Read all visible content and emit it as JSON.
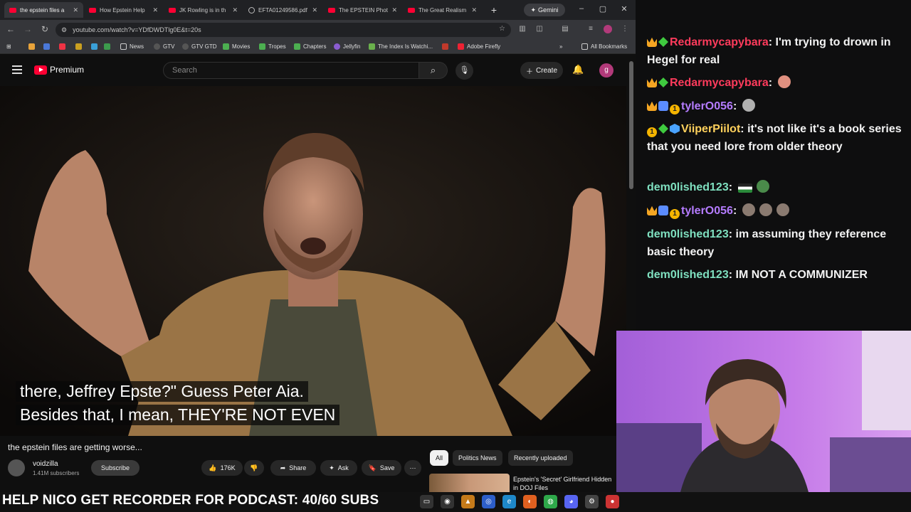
{
  "browser": {
    "tabs": [
      {
        "title": "the epstein files a",
        "active": true,
        "icon": "youtube-icon"
      },
      {
        "title": "How Epstein Help",
        "active": false,
        "icon": "youtube-icon"
      },
      {
        "title": "JK Rowling is in th",
        "active": false,
        "icon": "youtube-icon"
      },
      {
        "title": "EFTA01249586.pdf",
        "active": false,
        "icon": "document-icon"
      },
      {
        "title": "The EPSTEIN Phot",
        "active": false,
        "icon": "youtube-icon"
      },
      {
        "title": "The Great Realism",
        "active": false,
        "icon": "youtube-icon"
      }
    ],
    "gemini_label": "Gemini",
    "url": "youtube.com/watch?v=YDfDWDTlg0E&t=20s",
    "bookmarks": [
      "News",
      "GTV",
      "GTV GTD",
      "Movies",
      "Tropes",
      "Chapters",
      "Jellyfin",
      "The Index Is Watchi...",
      "Adobe Firefly"
    ],
    "all_bookmarks_label": "All Bookmarks"
  },
  "youtube": {
    "logo_label": "Premium",
    "search_placeholder": "Search",
    "create_label": "Create",
    "avatar_letter": "g",
    "captions": [
      "there, Jeffrey Epste?\" Guess Peter Aia.",
      "Besides that, I mean, THEY'RE NOT EVEN"
    ],
    "video_title": "the epstein files are getting worse...",
    "channel_name": "voidzilla",
    "channel_subs": "1.41M subscribers",
    "subscribe_label": "Subscribe",
    "likes": "176K",
    "share_label": "Share",
    "ask_label": "Ask",
    "save_label": "Save",
    "chips": [
      "All",
      "Politics News",
      "Recently uploaded"
    ],
    "recommended_title": "Epstein's 'Secret' Girlfriend Hidden in DOJ Files"
  },
  "chat": {
    "messages": [
      {
        "user": "Redarmycapybara",
        "color": "#ff3b5c",
        "text": "I'm trying to drown in Hegel for real",
        "badges": [
          "crown",
          "gem"
        ]
      },
      {
        "user": "Redarmycapybara",
        "color": "#ff3b5c",
        "text": "",
        "badges": [
          "crown",
          "gem"
        ],
        "emote": "#e09080"
      },
      {
        "user": "tylerO056",
        "color": "#b57cff",
        "text": "",
        "badges": [
          "crown",
          "grid",
          "one"
        ],
        "emote": "#b0b0b0"
      },
      {
        "user": "ViiperPiilot",
        "color": "#ffd15c",
        "text": "it's not like it's a book series that you need lore from older theory",
        "badges": [
          "one",
          "gem",
          "hex"
        ]
      },
      {
        "user": "dem0lished123",
        "color": "#7fe0c0",
        "text": "",
        "badges": [],
        "emote": "#4a8a4a"
      },
      {
        "user": "tylerO056",
        "color": "#b57cff",
        "text": "",
        "badges": [
          "crown",
          "grid",
          "one"
        ],
        "emote": "#8a7a70"
      },
      {
        "user": "dem0lished123",
        "color": "#7fe0c0",
        "text": "im assuming they reference basic theory",
        "badges": []
      },
      {
        "user": "dem0lished123",
        "color": "#7fe0c0",
        "text": "IM NOT A COMMUNIZER",
        "badges": []
      }
    ]
  },
  "ticker": {
    "text": "HELP NICO GET RECORDER FOR PODCAST: 40/60 SUBS"
  }
}
